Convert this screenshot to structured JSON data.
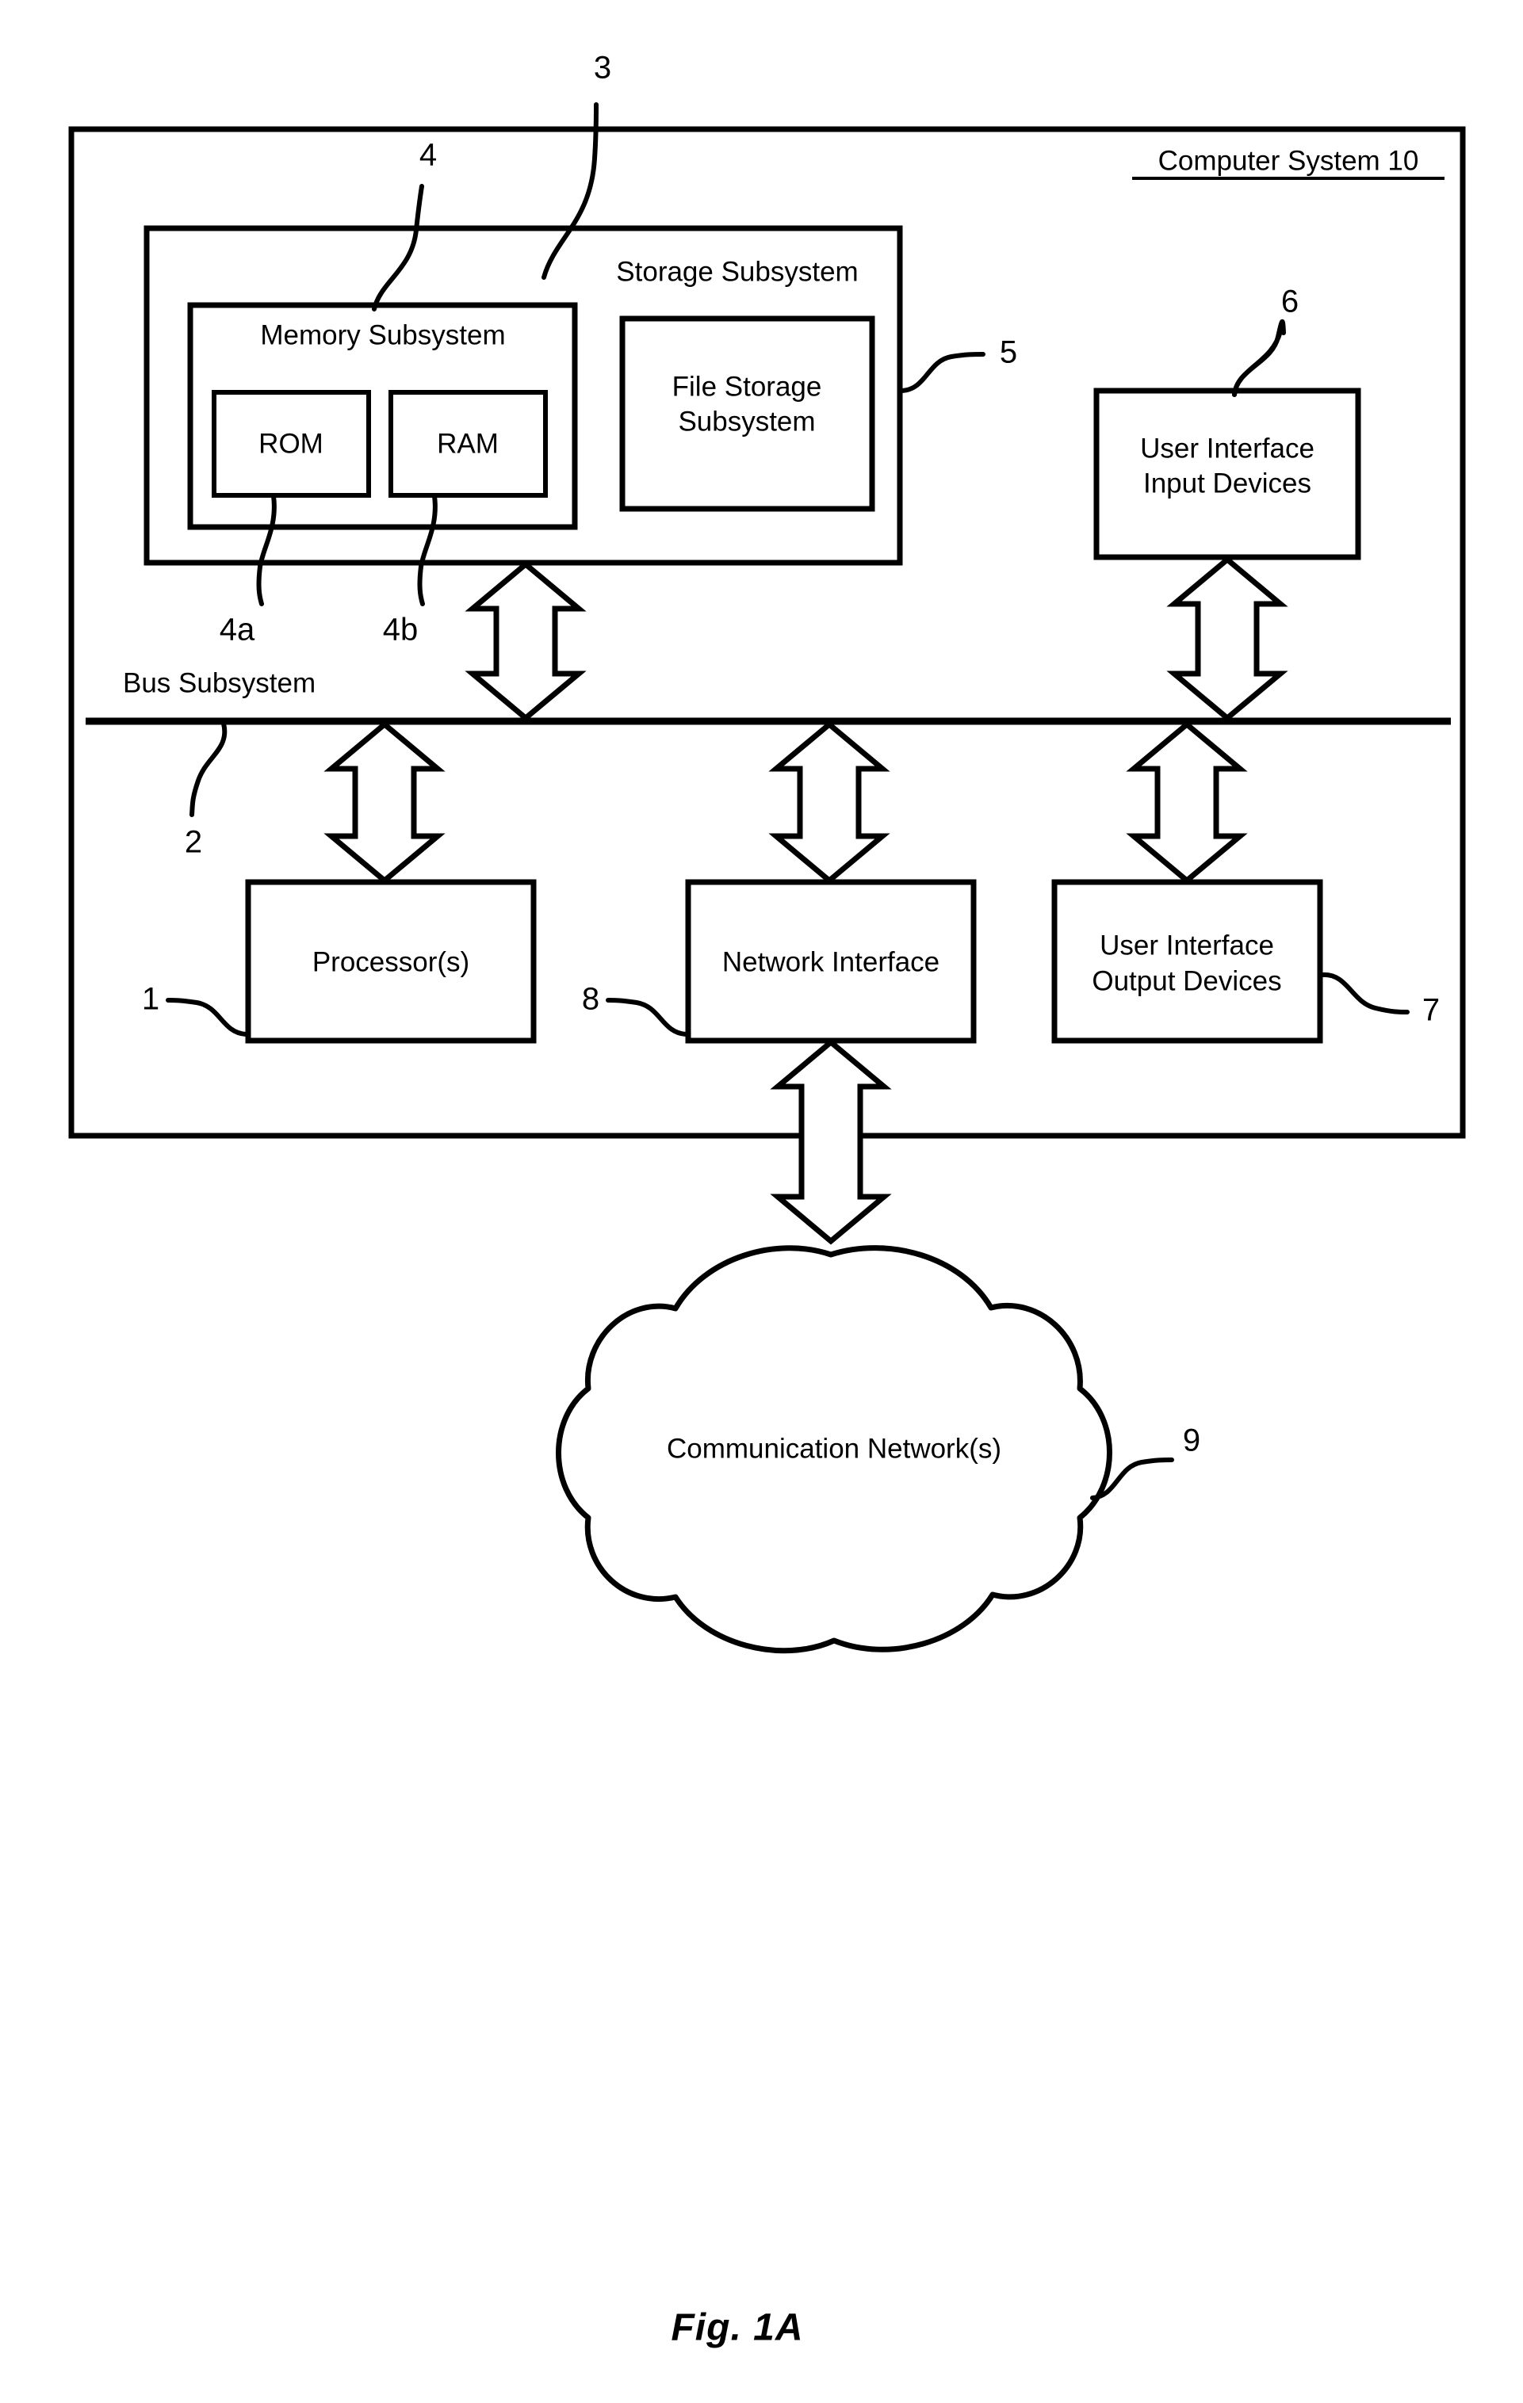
{
  "figure": {
    "caption": "Fig. 1A",
    "outer_label": "Computer System 10",
    "outer_label_underlined": true
  },
  "colors": {
    "stroke": "#000000",
    "fill": "#ffffff",
    "background": "#ffffff"
  },
  "blocks": {
    "computer_system": {
      "label": "Computer System 10",
      "ref": "10"
    },
    "storage_subsystem": {
      "label": "Storage Subsystem",
      "ref": "3"
    },
    "memory_subsystem": {
      "label": "Memory Subsystem",
      "ref": "4"
    },
    "rom": {
      "label": "ROM",
      "ref": "4a"
    },
    "ram": {
      "label": "RAM",
      "ref": "4b"
    },
    "file_storage_subsystem": {
      "label_line1": "File Storage",
      "label_line2": "Subsystem",
      "ref": "5"
    },
    "ui_input_devices": {
      "label_line1": "User Interface",
      "label_line2": "Input Devices",
      "ref": "6"
    },
    "bus_subsystem": {
      "label": "Bus Subsystem",
      "ref": "2"
    },
    "processors": {
      "label": "Processor(s)",
      "ref": "1"
    },
    "network_interface": {
      "label": "Network Interface",
      "ref": "8"
    },
    "ui_output_devices": {
      "label_line1": "User Interface",
      "label_line2": "Output Devices",
      "ref": "7"
    },
    "communication_networks": {
      "label": "Communication Network(s)",
      "ref": "9"
    }
  },
  "reference_numerals": {
    "one": "1",
    "two": "2",
    "three": "3",
    "four": "4",
    "four_a": "4a",
    "four_b": "4b",
    "five": "5",
    "six": "6",
    "seven": "7",
    "eight": "8",
    "nine": "9",
    "ten": "10"
  }
}
